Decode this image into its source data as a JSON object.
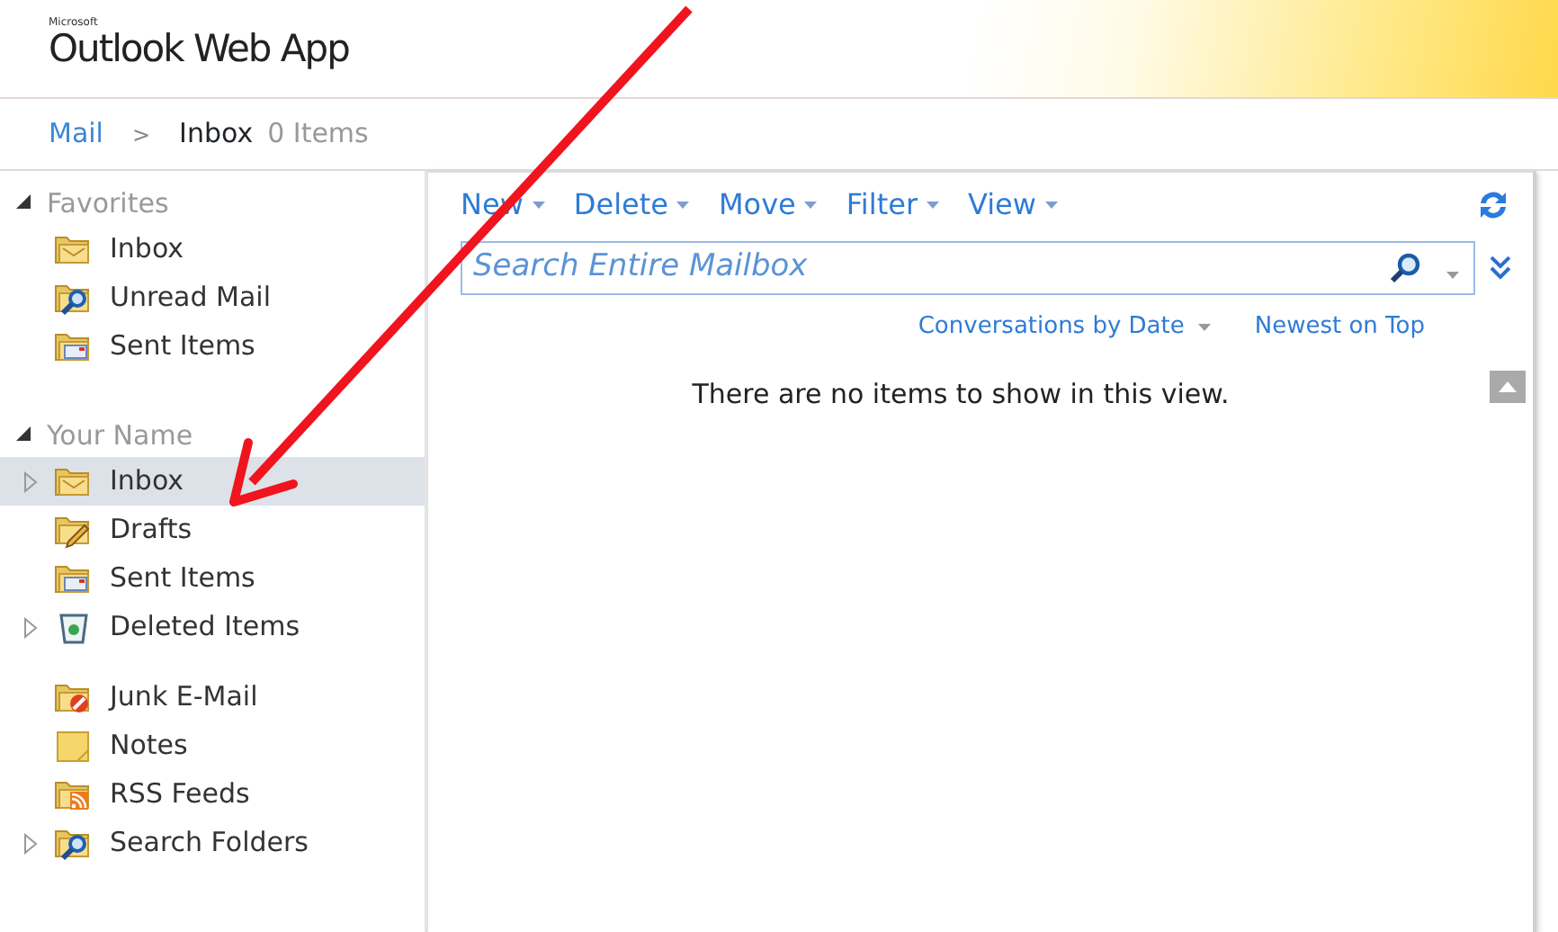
{
  "app": {
    "title": "Outlook Web App",
    "vendor": "Microsoft"
  },
  "breadcrumb": {
    "root": "Mail",
    "separator": ">",
    "folder": "Inbox",
    "count": "0 Items"
  },
  "sidebar": {
    "sections": [
      {
        "title": "Favorites",
        "expanded": true,
        "groups": [
          [
            {
              "label": "Inbox",
              "kind": "inbox",
              "expandable": false,
              "selected": false
            },
            {
              "label": "Unread Mail",
              "kind": "search",
              "expandable": false,
              "selected": false
            },
            {
              "label": "Sent Items",
              "kind": "sent",
              "expandable": false,
              "selected": false
            }
          ]
        ]
      },
      {
        "title": "Your Name",
        "expanded": true,
        "groups": [
          [
            {
              "label": "Inbox",
              "kind": "inbox",
              "expandable": true,
              "selected": true
            },
            {
              "label": "Drafts",
              "kind": "drafts",
              "expandable": false,
              "selected": false
            },
            {
              "label": "Sent Items",
              "kind": "sent",
              "expandable": false,
              "selected": false
            },
            {
              "label": "Deleted Items",
              "kind": "trash",
              "expandable": true,
              "selected": false
            }
          ],
          [
            {
              "label": "Junk E-Mail",
              "kind": "junk",
              "expandable": false,
              "selected": false
            },
            {
              "label": "Notes",
              "kind": "notes",
              "expandable": false,
              "selected": false
            },
            {
              "label": "RSS Feeds",
              "kind": "rss",
              "expandable": false,
              "selected": false
            },
            {
              "label": "Search Folders",
              "kind": "search",
              "expandable": true,
              "selected": false
            }
          ]
        ]
      }
    ]
  },
  "toolbar": {
    "buttons": [
      "New",
      "Delete",
      "Move",
      "Filter",
      "View"
    ]
  },
  "search": {
    "placeholder": "Search Entire Mailbox"
  },
  "sort": {
    "arrange": "Conversations by Date",
    "order": "Newest on Top"
  },
  "empty_message": "There are no items to show in this view.",
  "annotation": {
    "kind": "arrow"
  }
}
